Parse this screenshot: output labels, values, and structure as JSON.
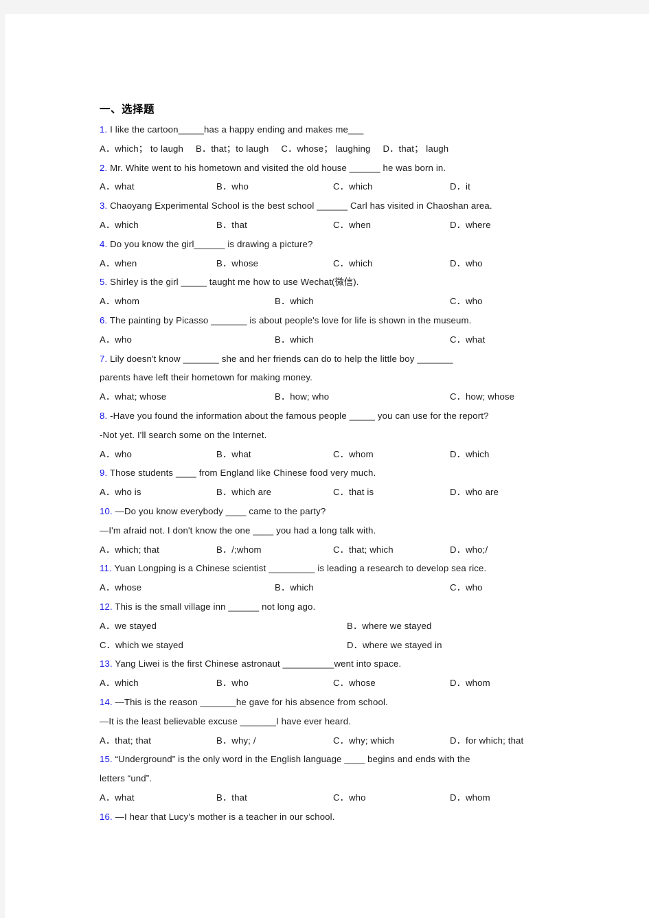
{
  "page": {
    "heading": "一、选择题"
  },
  "questions": [
    {
      "num": "1.",
      "lines": [
        "I like the cartoon_____has a happy ending and makes me___"
      ],
      "option_layout": "free",
      "options": [
        "A．which；  to laugh",
        "B．that；to laugh",
        "C．whose；  laughing",
        "D．that；  laugh"
      ]
    },
    {
      "num": "2.",
      "lines": [
        "Mr. White went to his hometown and visited the old house ______ he was born in."
      ],
      "option_layout": "w4",
      "options": [
        "A．what",
        "B．who",
        "C．which",
        "D．it"
      ]
    },
    {
      "num": "3.",
      "lines": [
        "Chaoyang Experimental School is the best school ______ Carl has visited in Chaoshan area."
      ],
      "option_layout": "w4",
      "options": [
        "A．which",
        "B．that",
        "C．when",
        "D．where"
      ]
    },
    {
      "num": "4.",
      "lines": [
        "Do you know the girl______ is drawing a picture?"
      ],
      "option_layout": "w4",
      "options": [
        "A．when",
        "B．whose",
        "C．which",
        "D．who"
      ]
    },
    {
      "num": "5.",
      "lines": [
        "Shirley is the girl _____ taught me how to use Wechat(微信)."
      ],
      "option_layout": "w3",
      "options": [
        "A．whom",
        "B．which",
        "C．who"
      ]
    },
    {
      "num": "6.",
      "lines": [
        "The painting by Picasso _______ is about people's love for life is shown in the museum."
      ],
      "option_layout": "w3",
      "options": [
        "A．who",
        "B．which",
        "C．what"
      ]
    },
    {
      "num": "7.",
      "lines": [
        "Lily doesn't know _______ she and her friends can do to help the little boy _______",
        "parents have left their hometown for making money."
      ],
      "option_layout": "w3",
      "options": [
        "A．what; whose",
        "B．how; who",
        "C．how; whose"
      ]
    },
    {
      "num": "8.",
      "lines": [
        "-Have you found the information about the famous people _____ you can use for the report?",
        " -Not yet. I'll search some on the Internet."
      ],
      "option_layout": "w4",
      "options": [
        "A．who",
        "B．what",
        "C．whom",
        "D．which"
      ]
    },
    {
      "num": "9.",
      "lines": [
        "Those students ____ from England like Chinese food very much."
      ],
      "option_layout": "w4",
      "options": [
        "A．who is",
        "B．which are",
        "C．that is",
        "D．who are"
      ]
    },
    {
      "num": "10.",
      "lines": [
        "—Do you know everybody ____   came to the party?",
        "—I'm afraid not. I don't know the one ____    you had a long talk with."
      ],
      "option_layout": "w4",
      "options": [
        "A．which; that",
        "B．/;whom",
        "C．that; which",
        "D．who;/"
      ]
    },
    {
      "num": "11.",
      "lines": [
        "Yuan Longping is a Chinese scientist _________ is leading a research to develop sea rice."
      ],
      "option_layout": "w3",
      "options": [
        "A．whose",
        "B．which",
        "C．who"
      ]
    },
    {
      "num": "12.",
      "lines": [
        "This is the small village inn ______ not long ago."
      ],
      "option_layout": "w2",
      "options": [
        "A．we stayed",
        "B．where we stayed",
        "C．which we stayed",
        "D．where we stayed in"
      ]
    },
    {
      "num": "13.",
      "lines": [
        "Yang Liwei is the first Chinese astronaut __________went into space."
      ],
      "option_layout": "w4",
      "options": [
        "A．which",
        "B．who",
        "C．whose",
        "D．whom"
      ]
    },
    {
      "num": "14.",
      "lines": [
        "—This is the reason _______he gave for his absence from school.",
        "—It is the least believable excuse _______I have ever heard."
      ],
      "option_layout": "w4",
      "options": [
        "A．that; that",
        "B．why; /",
        "C．why; which",
        "D．for which; that"
      ]
    },
    {
      "num": "15.",
      "lines": [
        "“Underground” is the only word in the English language ____ begins and ends with the",
        "letters “und”."
      ],
      "option_layout": "w4",
      "options": [
        "A．what",
        "B．that",
        "C．who",
        "D．whom"
      ]
    },
    {
      "num": "16.",
      "lines": [
        "—I hear that Lucy's mother is a teacher in our school."
      ],
      "option_layout": "none",
      "options": []
    }
  ]
}
